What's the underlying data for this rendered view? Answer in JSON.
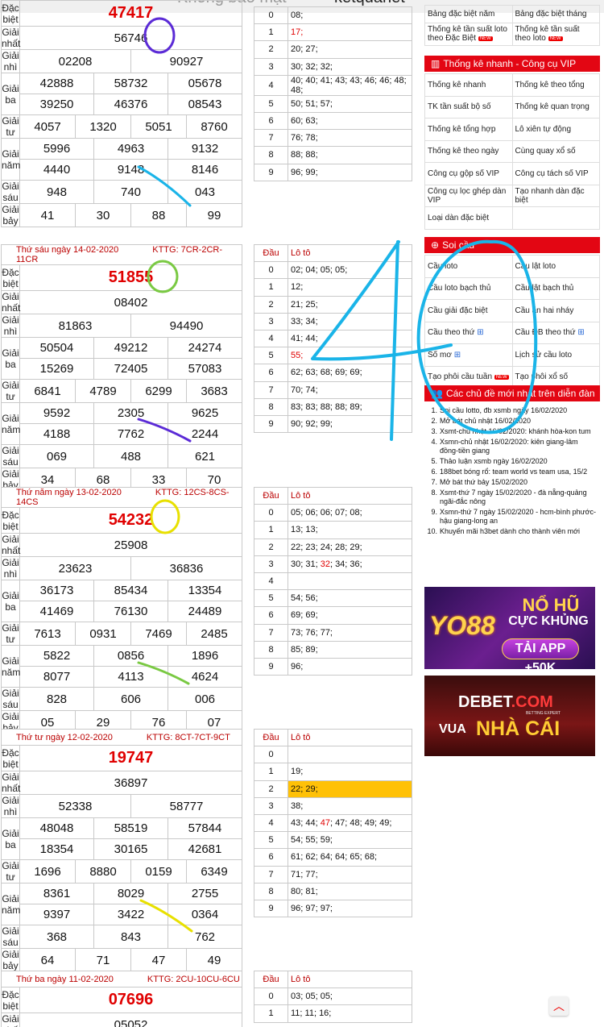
{
  "topbar": {
    "left_text": "Không bao mặt",
    "right_text": "ketquanet"
  },
  "labels": {
    "dac_biet": "Đặc biệt",
    "giai_nhat": "Giải nhất",
    "giai_nhi": "Giải nhì",
    "giai_ba": "Giải ba",
    "giai_tu": "Giải tư",
    "giai_nam": "Giải năm",
    "giai_sau": "Giải sáu",
    "giai_bay": "Giải bảy",
    "dau": "Đầu",
    "loto": "Lô tô"
  },
  "draws": [
    {
      "date": "",
      "kttg": "",
      "special": "47417",
      "first": "56746",
      "second": [
        "02208",
        "90927"
      ],
      "third": [
        "42888",
        "58732",
        "05678",
        "39250",
        "46376",
        "08543"
      ],
      "fourth": [
        "4057",
        "1320",
        "5051",
        "8760"
      ],
      "fifth": [
        "5996",
        "4963",
        "9132",
        "4440",
        "9148",
        "8146"
      ],
      "sixth": [
        "948",
        "740",
        "043"
      ],
      "seventh": [
        "41",
        "30",
        "88",
        "99"
      ],
      "loto": [
        {
          "d": "0",
          "v": "08;"
        },
        {
          "d": "1",
          "v": "17;"
        },
        {
          "d": "2",
          "v": "20; 27;"
        },
        {
          "d": "3",
          "v": "30; 32; 32;"
        },
        {
          "d": "4",
          "v": "40; 40; 41; 43; 43; 46; 46; 48; 48;"
        },
        {
          "d": "5",
          "v": "50; 51; 57;"
        },
        {
          "d": "6",
          "v": "60; 63;"
        },
        {
          "d": "7",
          "v": "76; 78;"
        },
        {
          "d": "8",
          "v": "88; 88;"
        },
        {
          "d": "9",
          "v": "96; 99;"
        }
      ]
    },
    {
      "date": "Thứ sáu ngày 14-02-2020",
      "kttg": "KTTG: 7CR-2CR-11CR",
      "special": "51855",
      "first": "08402",
      "second": [
        "81863",
        "94490"
      ],
      "third": [
        "50504",
        "49212",
        "24274",
        "15269",
        "72405",
        "57083"
      ],
      "fourth": [
        "6841",
        "4789",
        "6299",
        "3683"
      ],
      "fifth": [
        "9592",
        "2305",
        "9625",
        "4188",
        "7762",
        "2244"
      ],
      "sixth": [
        "069",
        "488",
        "621"
      ],
      "seventh": [
        "34",
        "68",
        "33",
        "70"
      ],
      "loto": [
        {
          "d": "0",
          "v": "02; 04; 05; 05;"
        },
        {
          "d": "1",
          "v": "12;"
        },
        {
          "d": "2",
          "v": "21; 25;"
        },
        {
          "d": "3",
          "v": "33; 34;"
        },
        {
          "d": "4",
          "v": "41; 44;"
        },
        {
          "d": "5",
          "v": "55;"
        },
        {
          "d": "6",
          "v": "62; 63; 68; 69; 69;"
        },
        {
          "d": "7",
          "v": "70; 74;"
        },
        {
          "d": "8",
          "v": "83; 83; 88; 88; 89;"
        },
        {
          "d": "9",
          "v": "90; 92; 99;"
        }
      ]
    },
    {
      "date": "Thứ năm ngày 13-02-2020",
      "kttg": "KTTG: 12CS-8CS-14CS",
      "special": "54232",
      "first": "25908",
      "second": [
        "23623",
        "36836"
      ],
      "third": [
        "36173",
        "85434",
        "13354",
        "41469",
        "76130",
        "24489"
      ],
      "fourth": [
        "7613",
        "0931",
        "7469",
        "2485"
      ],
      "fifth": [
        "5822",
        "0856",
        "1896",
        "8077",
        "4113",
        "4624"
      ],
      "sixth": [
        "828",
        "606",
        "006"
      ],
      "seventh": [
        "05",
        "29",
        "76",
        "07"
      ],
      "loto": [
        {
          "d": "0",
          "v": "05; 06; 06; 07; 08;"
        },
        {
          "d": "1",
          "v": "13; 13;"
        },
        {
          "d": "2",
          "v": "22; 23; 24; 28; 29;"
        },
        {
          "d": "3",
          "v": "30; 31; 32; 34; 36;"
        },
        {
          "d": "4",
          "v": ""
        },
        {
          "d": "5",
          "v": "54; 56;"
        },
        {
          "d": "6",
          "v": "69; 69;"
        },
        {
          "d": "7",
          "v": "73; 76; 77;"
        },
        {
          "d": "8",
          "v": "85; 89;"
        },
        {
          "d": "9",
          "v": "96;"
        }
      ]
    },
    {
      "date": "Thứ tư ngày 12-02-2020",
      "kttg": "KTTG: 8CT-7CT-9CT",
      "special": "19747",
      "first": "36897",
      "second": [
        "52338",
        "58777"
      ],
      "third": [
        "48048",
        "58519",
        "57844",
        "18354",
        "30165",
        "42681"
      ],
      "fourth": [
        "1696",
        "8880",
        "0159",
        "6349"
      ],
      "fifth": [
        "8361",
        "8029",
        "2755",
        "9397",
        "3422",
        "0364"
      ],
      "sixth": [
        "368",
        "843",
        "762"
      ],
      "seventh": [
        "64",
        "71",
        "47",
        "49"
      ],
      "loto": [
        {
          "d": "0",
          "v": ""
        },
        {
          "d": "1",
          "v": "19;"
        },
        {
          "d": "2",
          "v": "22; 29;"
        },
        {
          "d": "3",
          "v": "38;"
        },
        {
          "d": "4",
          "v": "43; 44; 47; 47; 48; 49; 49;"
        },
        {
          "d": "5",
          "v": "54; 55; 59;"
        },
        {
          "d": "6",
          "v": "61; 62; 64; 64; 65; 68;"
        },
        {
          "d": "7",
          "v": "71; 77;"
        },
        {
          "d": "8",
          "v": "80; 81;"
        },
        {
          "d": "9",
          "v": "96; 97; 97;"
        }
      ]
    },
    {
      "date": "Thứ ba ngày 11-02-2020",
      "kttg": "KTTG: 2CU-10CU-6CU",
      "special": "07696",
      "first": "05052",
      "loto": [
        {
          "d": "0",
          "v": "03; 05; 05;"
        },
        {
          "d": "1",
          "v": "11; 11; 16;"
        }
      ]
    }
  ],
  "loto_red": {
    "d0_1": "17;",
    "d1_5": "55;",
    "d2_3_red": "32",
    "d3_4_red": "47"
  },
  "sidebar": {
    "top_grid": [
      [
        "Bảng đặc biệt năm",
        "Bảng đặc biệt tháng"
      ],
      [
        "Thống kê tần suất loto theo Đặc Biệt",
        "Thống kê tần suất theo loto"
      ]
    ],
    "quick_head": "Thống kê nhanh - Công cụ VIP",
    "quick_grid": [
      [
        "Thống kê nhanh",
        "Thống kê theo tổng"
      ],
      [
        "TK tần suất bộ số",
        "Thống kê quan trọng"
      ],
      [
        "Thống kê tổng hợp",
        "Lô xiên tự động"
      ],
      [
        "Thống kê theo ngày",
        "Cùng quay xổ số"
      ],
      [
        "Công cụ gộp số VIP",
        "Công cụ tách số VIP"
      ],
      [
        "Công cụ lọc ghép dàn VIP",
        "Tạo nhanh dàn đặc biệt"
      ],
      [
        "Loại dàn đặc biệt",
        ""
      ]
    ],
    "soi_head": "Soi cầu",
    "soi_grid": [
      [
        "Cầu loto",
        "Cầu lật loto"
      ],
      [
        "Cầu loto bạch thủ",
        "Cầu lật bạch thủ"
      ],
      [
        "Cầu giải đặc biệt",
        "Cầu ăn hai nháy"
      ],
      [
        "Cầu theo thứ",
        "Cầu ĐB theo thứ"
      ],
      [
        "Số mơ",
        "Lịch sử cầu loto"
      ],
      [
        "Tạo phôi cầu tuần",
        "Tạo phôi xổ số"
      ]
    ],
    "new_badge": "NEW",
    "forum_head": "Các chủ đề mới nhất trên diễn đàn",
    "forum": [
      "Soi cầu lotto, đb xsmb ngày 16/02/2020",
      "Mở bát chủ nhật 16/02/2020",
      "Xsmt-chủ nhật 16/02/2020: khánh hòa-kon tum",
      "Xsmn-chủ nhật 16/02/2020: kiên giang-lâm đồng-tiền giang",
      "Thảo luận xsmb ngày 16/02/2020",
      "188bet bóng rổ: team world vs team usa, 15/2",
      "Mở bát thứ bảy 15/02/2020",
      "Xsmt-thứ 7 ngày 15/02/2020 - đà nẵng-quảng ngãi-đắc nông",
      "Xsmn-thứ 7 ngày 15/02/2020 - hcm-bình phước-hậu giang-long an",
      "Khuyến mãi h3bet dành cho thành viên mới"
    ]
  },
  "ads": {
    "yo88": {
      "logo": "YO88",
      "line1": "NỔ HŨ",
      "line2": "CỰC KHỦNG",
      "button": "TẢI APP +50K"
    },
    "debet": {
      "logo_a": "DEBET",
      "logo_b": ".COM",
      "sub": "BETTING EXPERT",
      "line1": "VUA",
      "line2": "NHÀ CÁI"
    }
  },
  "annotation": {
    "number": "4",
    "color": "#1ab4e8"
  }
}
